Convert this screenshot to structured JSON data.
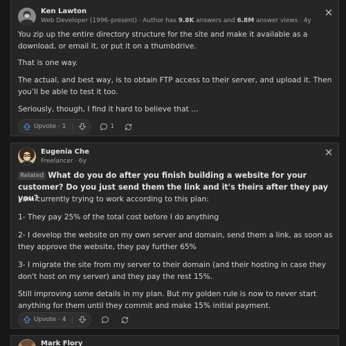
{
  "answers": [
    {
      "author": "Ken Lawton",
      "credential_prefix": "Web Developer (1996–present) · Author has ",
      "answers_count": "9.8K",
      "answers_label": " answers and ",
      "views_count": "6.8M",
      "views_label": " answer views · 4y",
      "paragraphs": [
        "You zip up the entire directory structure for the site and make it available as a download, or email it, or put it on a thumbdrive.",
        "That is one way.",
        "The actual, and best way, is to obtain FTP access to their server, and upload it. Then you’ll be able to test it too.",
        "Seriously, though, I find it hard to believe that ..."
      ],
      "upvote_label": "Upvote · 1",
      "comment_count": "1",
      "icons": [
        "arrow-up",
        "arrow-down",
        "comment-bubble",
        "share-arrows",
        "close-x"
      ]
    },
    {
      "author": "Eugenia Che",
      "credential": "Freelancer · 6y",
      "related_badge": "Related",
      "question": "What do you do after you finish building a website for your customer? Do you just send them the link and it's theirs after they pay you?",
      "paragraphs": [
        "I am currently trying to work according to this plan:",
        "1- They pay 25% of the total cost before I do anything",
        "2- I develop the website on my own server and domain, send them a link, as soon as they approve the website, they pay further 65%",
        "3- I migrate the site from my server to their domain (and their hosting in case they don't host on my server) and they pay the rest 15%.",
        "Still improving some details in my plan. But my golden rule is now to never start anything for them until they commit and make 15% initial payment."
      ],
      "upvote_label": "Upvote · 4",
      "icons": [
        "arrow-up",
        "arrow-down",
        "comment-bubble",
        "share-arrows",
        "close-x"
      ]
    },
    {
      "author": "Mark Flory"
    }
  ],
  "colors": {
    "background": "#181818",
    "card": "#262626",
    "card_border": "#393939",
    "text": "#d5d6d6",
    "muted": "#a0a0a0",
    "upvote_icon": "#4a8fd8"
  }
}
